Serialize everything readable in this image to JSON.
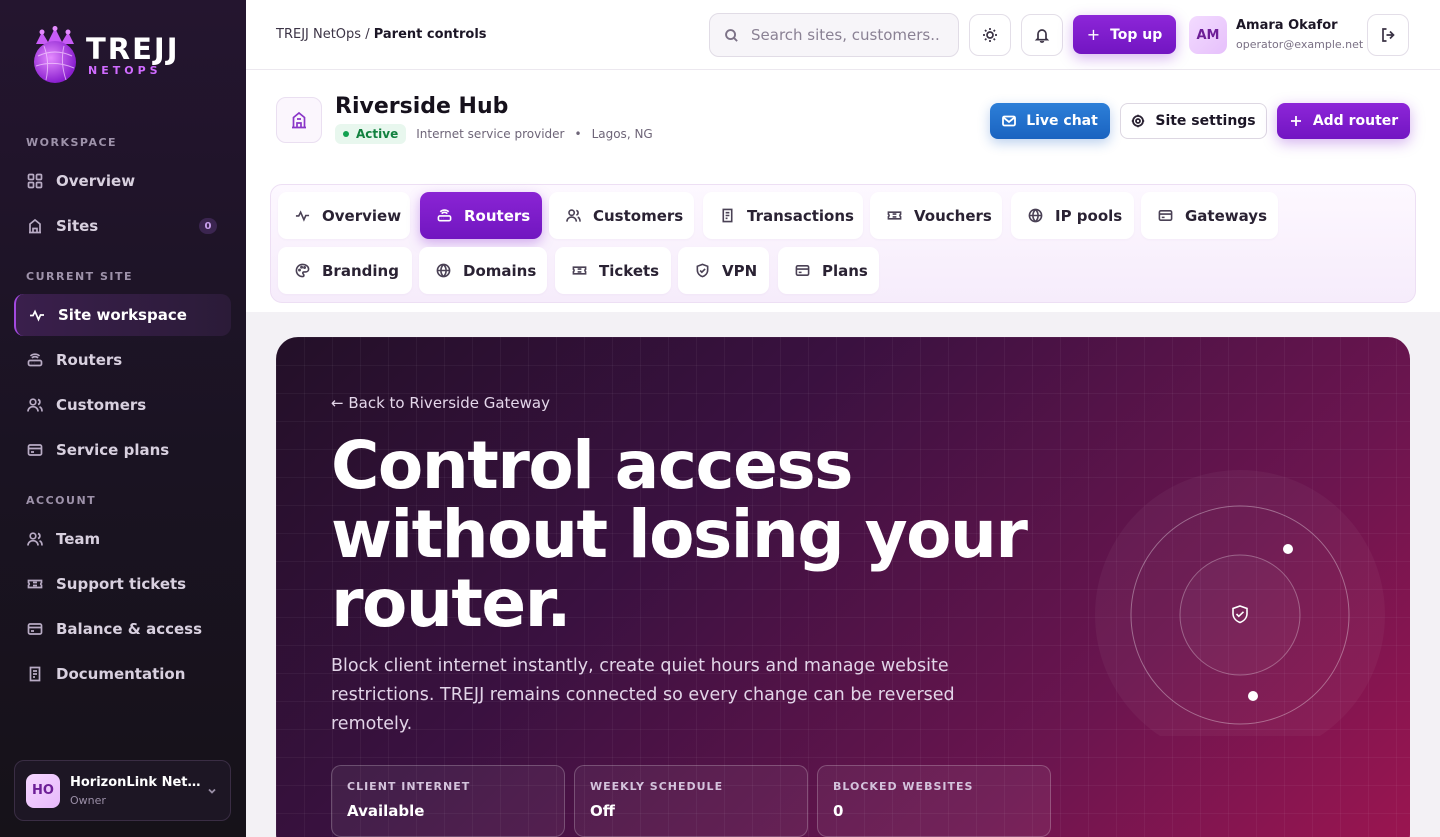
{
  "brand": {
    "name": "TREJJ",
    "sub": "NETOPS"
  },
  "sidebar": {
    "sections": {
      "workspace": "WORKSPACE",
      "current_site": "CURRENT SITE",
      "account": "ACCOUNT"
    },
    "workspace_items": [
      {
        "label": "Overview",
        "icon": "grid-icon"
      },
      {
        "label": "Sites",
        "icon": "building-icon",
        "count": "0"
      }
    ],
    "site_items": [
      {
        "label": "Site workspace",
        "icon": "activity-icon",
        "active": true
      },
      {
        "label": "Routers",
        "icon": "router-icon"
      },
      {
        "label": "Customers",
        "icon": "users-icon"
      },
      {
        "label": "Service plans",
        "icon": "card-icon"
      }
    ],
    "account_items": [
      {
        "label": "Team",
        "icon": "users-icon"
      },
      {
        "label": "Support tickets",
        "icon": "ticket-icon"
      },
      {
        "label": "Balance & access",
        "icon": "card-icon"
      },
      {
        "label": "Documentation",
        "icon": "doc-icon"
      }
    ],
    "org": {
      "initials": "HO",
      "name": "HorizonLink Net…",
      "role": "Owner"
    }
  },
  "topbar": {
    "breadcrumb_root": "TREJJ NetOps /",
    "breadcrumb_current": "Parent controls",
    "search_placeholder": "Search sites, customers...",
    "topup_label": "Top up",
    "user": {
      "initials": "AM",
      "name": "Amara Okafor",
      "email": "operator@example.net"
    }
  },
  "site": {
    "name": "Riverside Hub",
    "status": "Active",
    "type": "Internet service provider",
    "bullet": "•",
    "location": "Lagos, NG",
    "actions": {
      "chat": "Live chat",
      "settings": "Site settings",
      "add_router": "Add router"
    },
    "tabs": [
      {
        "label": "Overview",
        "icon": "activity-icon"
      },
      {
        "label": "Routers",
        "icon": "router-icon",
        "active": true
      },
      {
        "label": "Customers",
        "icon": "users-icon"
      },
      {
        "label": "Transactions",
        "icon": "receipt-icon"
      },
      {
        "label": "Vouchers",
        "icon": "ticket-icon"
      },
      {
        "label": "IP pools",
        "icon": "globe-icon"
      },
      {
        "label": "Gateways",
        "icon": "card-icon"
      },
      {
        "label": "Branding",
        "icon": "palette-icon"
      },
      {
        "label": "Domains",
        "icon": "globe-icon"
      },
      {
        "label": "Tickets",
        "icon": "ticket-icon"
      },
      {
        "label": "VPN",
        "icon": "shield-icon"
      },
      {
        "label": "Plans",
        "icon": "card-icon"
      }
    ]
  },
  "hero": {
    "back_link": "← Back to Riverside Gateway",
    "title": "Control access without losing your router.",
    "description": "Block client internet instantly, create quiet hours and manage website restrictions. TREJJ remains connected so every change can be reversed remotely.",
    "stats": [
      {
        "label": "CLIENT INTERNET",
        "value": "Available"
      },
      {
        "label": "WEEKLY SCHEDULE",
        "value": "Off"
      },
      {
        "label": "BLOCKED WEBSITES",
        "value": "0"
      }
    ]
  }
}
